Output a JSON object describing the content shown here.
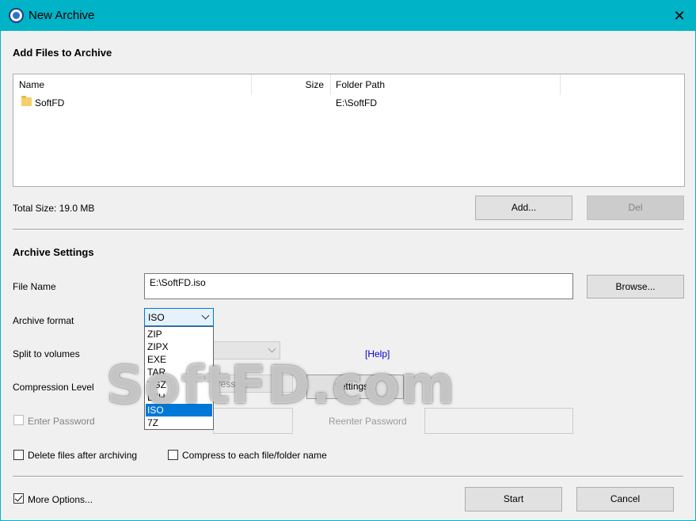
{
  "window": {
    "title": "New Archive",
    "close": "✕"
  },
  "add_files": {
    "heading": "Add Files to Archive",
    "columns": {
      "name": "Name",
      "size": "Size",
      "path": "Folder Path"
    },
    "rows": [
      {
        "name": "SoftFD",
        "size": "",
        "path": "E:\\SoftFD"
      }
    ],
    "total_size": "Total Size: 19.0 MB",
    "add_label": "Add...",
    "del_label": "Del"
  },
  "settings": {
    "heading": "Archive Settings",
    "file_name_label": "File Name",
    "file_name_value": "E:\\SoftFD.iso",
    "browse_label": "Browse...",
    "format_label": "Archive format",
    "format_value": "ISO",
    "format_options": [
      "ZIP",
      "ZIPX",
      "EXE",
      "TAR",
      "TGZ",
      "LZH",
      "ISO",
      "7Z"
    ],
    "split_label": "Split to volumes",
    "help_label": "[Help]",
    "compression_label": "Compression Level",
    "compression_value": "pression",
    "settings_label": "Settings...",
    "password_label": "Enter Password",
    "reenter_label": "Reenter Password",
    "delete_after_label": "Delete files after archiving",
    "compress_each_label": "Compress to each file/folder name"
  },
  "footer": {
    "more_options_label": "More Options...",
    "start_label": "Start",
    "cancel_label": "Cancel"
  },
  "watermark": "SoftFD.com"
}
